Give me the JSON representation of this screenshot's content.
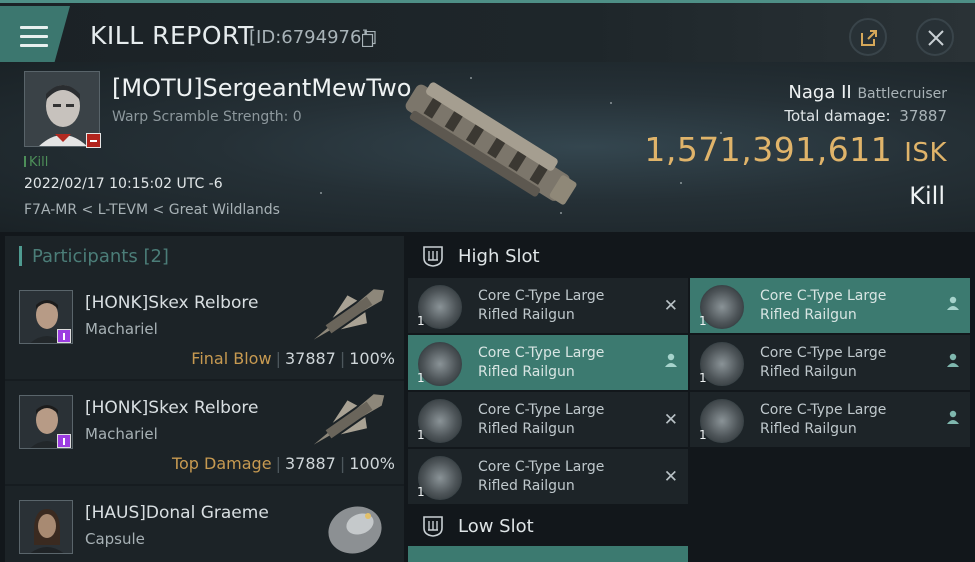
{
  "header": {
    "title": "KILL REPORT",
    "report_id": "[ID:6794976]"
  },
  "victim": {
    "name": "[MOTU]SergeantMewTwo",
    "warp_scramble": "Warp Scramble Strength: 0",
    "tag": "Kill",
    "datetime": "2022/02/17 10:15:02 UTC -6",
    "location": "F7A-MR < L-TEVM < Great Wildlands",
    "ship_name": "Naga II",
    "ship_class": "Battlecruiser",
    "total_damage_label": "Total damage:",
    "total_damage": "37887",
    "isk_value": "1,571,391,611",
    "isk_unit": "ISK",
    "result": "Kill"
  },
  "participants": {
    "title": "Participants [2]",
    "rows": [
      {
        "name": "[HONK]Skex Relbore",
        "ship": "Machariel",
        "role": "Final Blow",
        "damage": "37887",
        "percent": "100%"
      },
      {
        "name": "[HONK]Skex Relbore",
        "ship": "Machariel",
        "role": "Top Damage",
        "damage": "37887",
        "percent": "100%"
      },
      {
        "name": "[HAUS]Donal Graeme",
        "ship": "Capsule"
      }
    ]
  },
  "slots": {
    "high_title": "High Slot",
    "low_title": "Low Slot",
    "modules": [
      {
        "name": "Core C-Type Large Rifled Railgun",
        "qty": "1",
        "status": "destroyed",
        "highlight": false
      },
      {
        "name": "Core C-Type Large Rifled Railgun",
        "qty": "1",
        "status": "dropped",
        "highlight": true
      },
      {
        "name": "Core C-Type Large Rifled Railgun",
        "qty": "1",
        "status": "dropped",
        "highlight": true
      },
      {
        "name": "Core C-Type Large Rifled Railgun",
        "qty": "1",
        "status": "dropped",
        "highlight": false
      },
      {
        "name": "Core C-Type Large Rifled Railgun",
        "qty": "1",
        "status": "destroyed",
        "highlight": false
      },
      {
        "name": "Core C-Type Large Rifled Railgun",
        "qty": "1",
        "status": "dropped",
        "highlight": false
      },
      {
        "name": "Core C-Type Large Rifled Railgun",
        "qty": "1",
        "status": "destroyed",
        "highlight": false
      }
    ]
  },
  "colors": {
    "accent": "#3c7a70",
    "isk": "#e0b46a",
    "final_blow": "#c79a51"
  }
}
